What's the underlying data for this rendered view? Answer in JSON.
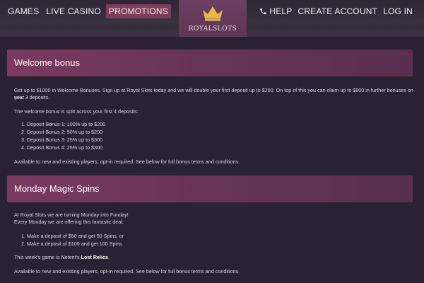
{
  "nav": {
    "left": [
      "GAMES",
      "LIVE CASINO",
      "PROMOTIONS"
    ],
    "right": {
      "help": "HELP",
      "create_account": "CREATE ACCOUNT",
      "login": "LOG IN"
    }
  },
  "logo": {
    "text": "ROYALSLOTS"
  },
  "colors": {
    "accent": "#7d3d5a",
    "header_bg": "#6a3556",
    "page_bg": "#2a2233"
  },
  "welcome": {
    "title": "Welcome bonus",
    "intro_1": "Get up to $1000 in Welcome Bonuses. Sign up at Royal Slots today and we will double your first deposit up to $200. On top of this you can claim up to $800 in further bonuses on your",
    "intro_2": "next 3 deposits.",
    "split": "The welcome bonus is split across your first 4 deposits:",
    "items": [
      "1. Deposit Bonus 1: 100% up to $200",
      "2. Deposit Bonus 2: 50% up to $200",
      "3. Deposit Bonus 3: 25% up to $300",
      "4. Deposit Bonus 4: 25% up to $300"
    ],
    "note": "Available to new and existing players, opt-in required. See below for full bonus terms and conditions."
  },
  "monday": {
    "title": "Monday Magic Spins",
    "intro_1": "At Royal Slots we are turning Monday into Funday!",
    "intro_2": "Every Monday we are offering this fantastic deal:",
    "items": [
      "1. Make a deposit of $50 and get 50 Spins, or",
      "2. Make a deposit of $100 and get 100 Spins"
    ],
    "game_prefix": "This week's game is Netent's ",
    "game_name": "Lost Relics",
    "game_suffix": ".",
    "note": "Available to new and existing players, opt-in required. See below for full bonus terms and conditions."
  }
}
